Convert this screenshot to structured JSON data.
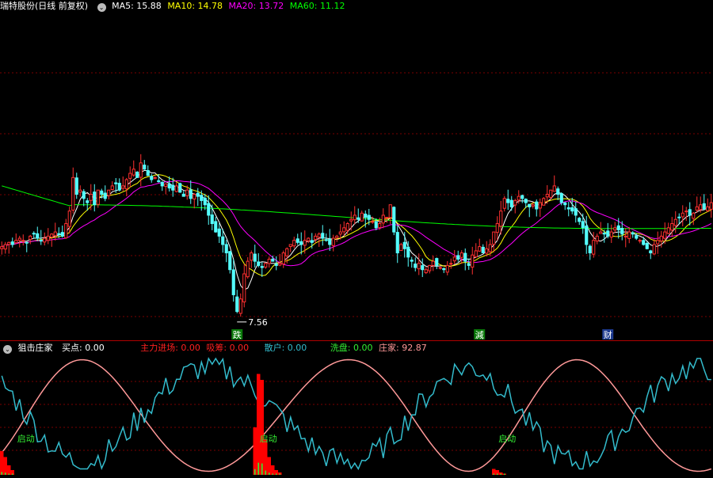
{
  "price_panel": {
    "title": "瑞特股份(日线 前复权)",
    "ma": [
      {
        "label": "MA5: 15.88",
        "color": "#ffffff"
      },
      {
        "label": "MA10: 14.78",
        "color": "#ffff00"
      },
      {
        "label": "MA20: 13.72",
        "color": "#ff00ff"
      },
      {
        "label": "MA60: 11.12",
        "color": "#00ff00"
      }
    ],
    "low_marker": "7.56",
    "event_labels": [
      {
        "text": "跌",
        "color": "#ffffff",
        "bg": "#0a7a0a",
        "bar": 66
      },
      {
        "text": "減",
        "color": "#ffffff",
        "bg": "#0a7a0a",
        "bar": 134
      },
      {
        "text": "财",
        "color": "#ffffff",
        "bg": "#1d3a8f",
        "bar": 170
      }
    ]
  },
  "indicator_panel": {
    "name": "狙击庄家",
    "items": [
      {
        "label": "买点: 0.00",
        "color": "#ffffff"
      },
      {
        "label": "主力进场: 0.00",
        "color": "#ff2020"
      },
      {
        "label": "吸筹: 0.00",
        "color": "#ff2020"
      },
      {
        "label": "散户: 0.00",
        "color": "#33bbcc"
      },
      {
        "label": "洗盘: 0.00",
        "color": "#33ee33"
      },
      {
        "label": "庄家: 92.87",
        "color": "#ff9999"
      }
    ],
    "qidong_labels": [
      {
        "text": "启动",
        "bar": 5
      },
      {
        "text": "启动",
        "bar": 73
      },
      {
        "text": "启动",
        "bar": 140
      },
      {
        "text": "启动",
        "bar": 203
      }
    ]
  },
  "colors": {
    "up": "#ff3030",
    "down": "#54ffff",
    "grid": "#7a0000"
  },
  "chart_data": [
    {
      "type": "candlestick",
      "title": "瑞特股份(日线 前复权)",
      "series": [
        {
          "name": "MA5",
          "value": 15.88
        },
        {
          "name": "MA10",
          "value": 14.78
        },
        {
          "name": "MA20",
          "value": 13.72
        },
        {
          "name": "MA60",
          "value": 11.12
        }
      ],
      "annotations": [
        "7.56",
        "跌",
        "減",
        "财"
      ],
      "close": [
        10.9,
        11.0,
        11.1,
        11.0,
        11.2,
        11.3,
        11.2,
        11.1,
        11.4,
        11.5,
        11.3,
        11.2,
        11.3,
        11.4,
        11.5,
        11.6,
        11.5,
        11.4,
        12.0,
        12.6,
        14.2,
        13.4,
        13.6,
        13.2,
        13.0,
        13.4,
        12.9,
        13.6,
        13.4,
        13.2,
        13.6,
        13.8,
        13.9,
        13.6,
        13.8,
        14.1,
        14.4,
        14.6,
        14.2,
        14.9,
        14.6,
        14.3,
        14.1,
        14.2,
        14.0,
        13.8,
        13.9,
        13.7,
        13.6,
        13.8,
        13.5,
        13.3,
        13.6,
        13.2,
        13.4,
        13.3,
        13.1,
        12.9,
        12.4,
        12.0,
        11.6,
        11.4,
        11.0,
        10.6,
        9.8,
        8.6,
        7.8,
        8.4,
        9.6,
        10.2,
        10.6,
        10.2,
        10.0,
        9.9,
        10.1,
        10.3,
        10.2,
        10.0,
        10.1,
        10.6,
        10.8,
        11.0,
        11.2,
        11.1,
        11.0,
        11.2,
        11.3,
        11.1,
        11.4,
        11.5,
        11.3,
        11.2,
        11.0,
        11.3,
        11.4,
        11.6,
        11.8,
        12.0,
        12.2,
        12.4,
        12.2,
        12.5,
        12.3,
        12.2,
        12.1,
        11.8,
        12.0,
        12.4,
        12.3,
        12.9,
        11.6,
        10.6,
        11.0,
        10.8,
        10.4,
        10.2,
        9.9,
        10.1,
        9.8,
        9.8,
        10.0,
        10.2,
        10.0,
        9.9,
        9.8,
        10.0,
        10.1,
        10.4,
        10.3,
        10.6,
        10.2,
        10.0,
        10.5,
        10.7,
        10.9,
        10.6,
        10.8,
        11.0,
        11.6,
        12.0,
        12.6,
        13.2,
        13.0,
        12.8,
        13.1,
        13.3,
        13.2,
        13.0,
        12.8,
        12.9,
        12.7,
        13.0,
        13.2,
        13.4,
        13.6,
        13.8,
        13.4,
        13.0,
        12.9,
        12.7,
        12.6,
        12.4,
        12.1,
        11.8,
        11.0,
        10.6,
        11.2,
        11.4,
        11.6,
        11.5,
        11.4,
        11.6,
        11.8,
        11.7,
        11.5,
        11.4,
        11.6,
        11.5,
        11.3,
        11.2,
        11.0,
        10.8,
        10.6,
        11.0,
        11.2,
        11.4,
        11.6,
        11.8,
        12.0,
        12.2,
        12.3,
        12.5,
        12.6,
        12.4,
        12.5,
        12.8,
        12.9,
        12.7,
        12.8,
        13.0
      ],
      "volume_bars": {
        "qidong_at": [
          5,
          73,
          140,
          203
        ]
      }
    },
    {
      "type": "line",
      "title": "狙击庄家",
      "series": [
        {
          "name": "散户",
          "value": 0.0
        },
        {
          "name": "庄家",
          "value": 92.87
        },
        {
          "name": "主力进场",
          "value": 0.0
        },
        {
          "name": "吸筹",
          "value": 0.0
        },
        {
          "name": "洗盘",
          "value": 0.0
        },
        {
          "name": "买点",
          "value": 0.0
        }
      ]
    }
  ]
}
